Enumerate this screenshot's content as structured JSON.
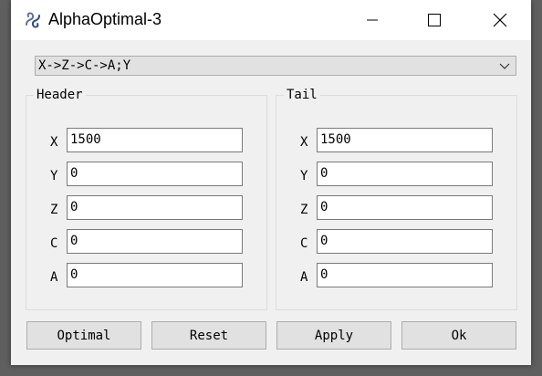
{
  "window": {
    "title": "AlphaOptimal-3"
  },
  "titlebar": {
    "icon": "app-logo-icon",
    "minimize_icon": "minimize-icon",
    "maximize_icon": "maximize-icon",
    "close_icon": "close-icon"
  },
  "sequence_select": {
    "selected": "X->Z->C->A;Y",
    "arrow_icon": "chevron-down-icon"
  },
  "header_group": {
    "title": "Header",
    "fields": [
      {
        "label": "X",
        "value": "1500"
      },
      {
        "label": "Y",
        "value": "0"
      },
      {
        "label": "Z",
        "value": "0"
      },
      {
        "label": "C",
        "value": "0"
      },
      {
        "label": "A",
        "value": "0"
      }
    ]
  },
  "tail_group": {
    "title": "Tail",
    "fields": [
      {
        "label": "X",
        "value": "1500"
      },
      {
        "label": "Y",
        "value": "0"
      },
      {
        "label": "Z",
        "value": "0"
      },
      {
        "label": "C",
        "value": "0"
      },
      {
        "label": "A",
        "value": "0"
      }
    ]
  },
  "buttons": {
    "optimal": "Optimal",
    "reset": "Reset",
    "apply": "Apply",
    "ok": "Ok"
  },
  "colors": {
    "window_background": "#f0f0f0",
    "button_face": "#e1e1e1",
    "app_icon_accent": "#5a6fa8"
  }
}
